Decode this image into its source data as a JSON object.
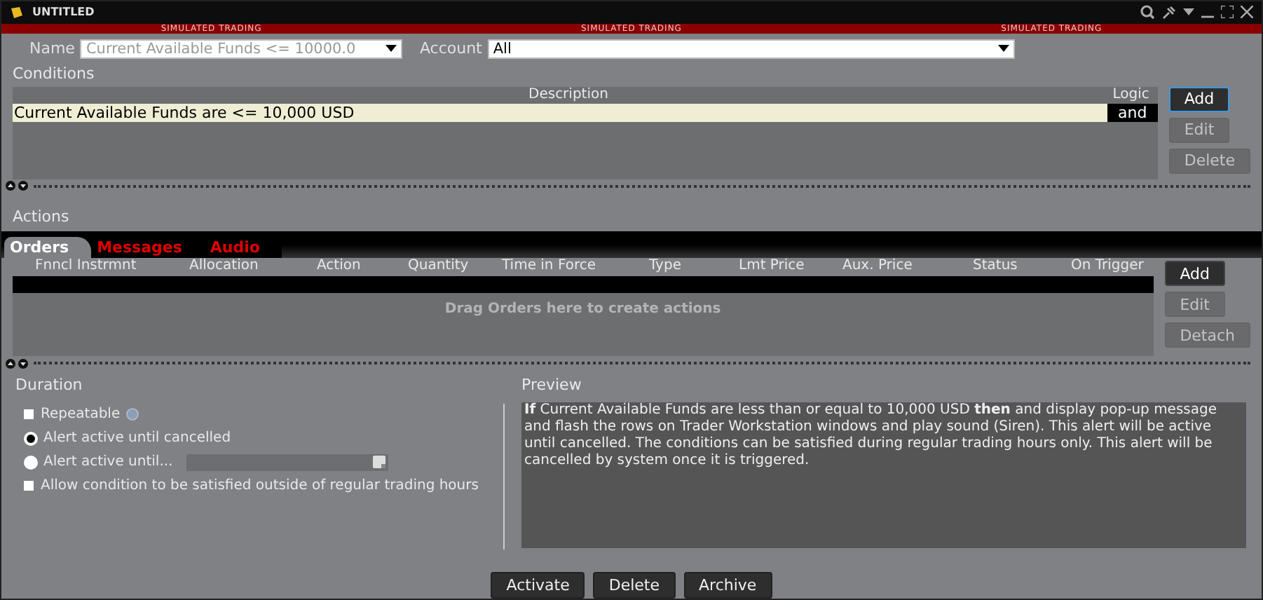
{
  "window": {
    "title": "UNTITLED"
  },
  "banner": [
    "SIMULATED TRADING",
    "SIMULATED TRADING",
    "SIMULATED TRADING"
  ],
  "name_field": {
    "label": "Name",
    "value": "Current Available Funds <= 10000.0"
  },
  "account_field": {
    "label": "Account",
    "value": "All"
  },
  "conditions": {
    "title": "Conditions",
    "columns": [
      "Description",
      "Logic"
    ],
    "rows": [
      {
        "description": "Current Available Funds are <= 10,000 USD",
        "logic": "and",
        "selected": true
      }
    ],
    "buttons": [
      {
        "label": "Add",
        "disabled": false,
        "focused": true
      },
      {
        "label": "Edit",
        "disabled": true,
        "focused": false
      },
      {
        "label": "Delete",
        "disabled": true,
        "focused": false
      }
    ]
  },
  "actions": {
    "title": "Actions",
    "tabs": [
      {
        "label": "Orders",
        "selected": true
      },
      {
        "label": "Messages",
        "selected": false
      },
      {
        "label": "Audio",
        "selected": false
      }
    ],
    "columns": [
      "Fnncl Instrmnt",
      "Allocation",
      "Action",
      "Quantity",
      "Time in Force",
      "Type",
      "Lmt Price",
      "Aux. Price",
      "Status",
      "On Trigger"
    ],
    "empty_text": "Drag Orders here to create actions",
    "buttons": [
      {
        "label": "Add",
        "disabled": false,
        "focused": false
      },
      {
        "label": "Edit",
        "disabled": true,
        "focused": false
      },
      {
        "label": "Detach",
        "disabled": true,
        "focused": false
      }
    ]
  },
  "duration": {
    "title": "Duration",
    "options": [
      {
        "kind": "checkbox",
        "label": "Repeatable",
        "checked": false,
        "info": true
      },
      {
        "kind": "radio",
        "label": "Alert active until cancelled",
        "checked": true,
        "info": false
      },
      {
        "kind": "radio",
        "label": "Alert active until...",
        "checked": false,
        "info": false,
        "date_field": true
      },
      {
        "kind": "checkbox",
        "label": "Allow condition to be satisfied outside of regular trading hours",
        "checked": false,
        "info": false
      }
    ]
  },
  "preview": {
    "title": "Preview",
    "text": "**If** Current Available Funds are less than or equal to 10,000 USD **then** and display pop-up message and flash the rows on Trader Workstation windows and play sound (Siren). This alert will be active until cancelled. The conditions can be satisfied during regular trading hours only. This alert will be cancelled by system once it is triggered."
  },
  "footer_buttons": [
    "Activate",
    "Delete",
    "Archive"
  ]
}
